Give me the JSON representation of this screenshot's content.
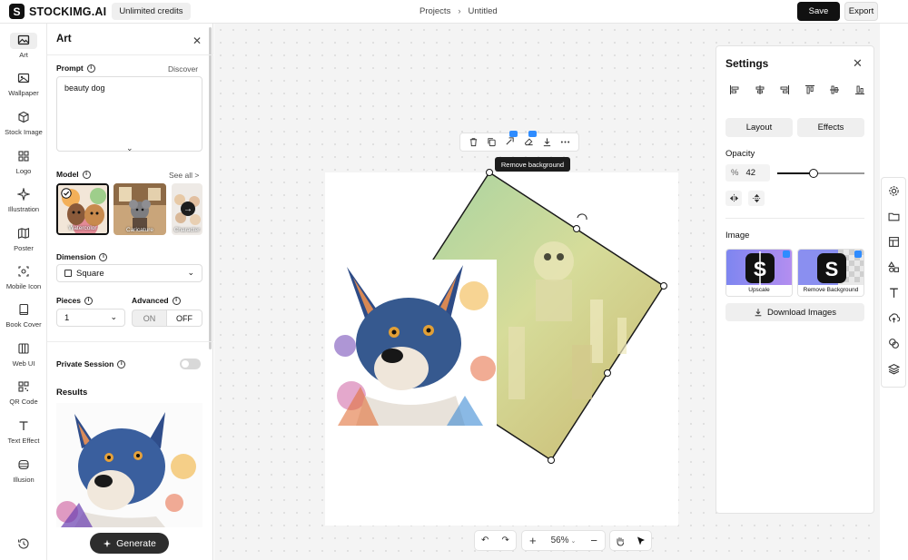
{
  "app": {
    "brand": "STOCKIMG.AI",
    "logo_letter": "S",
    "credits": "Unlimited credits",
    "breadcrumb": [
      "Projects",
      "Untitled"
    ],
    "save_label": "Save",
    "export_label": "Export"
  },
  "sidebar": {
    "items": [
      {
        "label": "Art",
        "icon": "image-icon",
        "active": true
      },
      {
        "label": "Wallpaper",
        "icon": "wallpaper-icon"
      },
      {
        "label": "Stock Image",
        "icon": "cube-icon"
      },
      {
        "label": "Logo",
        "icon": "grid-icon"
      },
      {
        "label": "Illustration",
        "icon": "sparkle-icon"
      },
      {
        "label": "Poster",
        "icon": "map-icon"
      },
      {
        "label": "Mobile Icon",
        "icon": "target-icon"
      },
      {
        "label": "Book Cover",
        "icon": "book-icon"
      },
      {
        "label": "Web UI",
        "icon": "columns-icon"
      },
      {
        "label": "QR Code",
        "icon": "qr-icon"
      },
      {
        "label": "Text Effect",
        "icon": "text-icon"
      },
      {
        "label": "Illusion",
        "icon": "layers-icon"
      }
    ],
    "history_icon": "history-icon"
  },
  "panel": {
    "title": "Art",
    "prompt_label": "Prompt",
    "discover": "Discover",
    "prompt_value": "beauty dog",
    "model_label": "Model",
    "see_all": "See all >",
    "models": [
      {
        "name": "Watercolor",
        "selected": true
      },
      {
        "name": "Caricature",
        "selected": false
      },
      {
        "name": "Character",
        "selected": false
      }
    ],
    "dimension_label": "Dimension",
    "dimension_value": "Square",
    "pieces_label": "Pieces",
    "pieces_value": "1",
    "advanced_label": "Advanced",
    "advanced_on": "ON",
    "advanced_off": "OFF",
    "advanced_state": "OFF",
    "private_label": "Private Session",
    "private_enabled": false,
    "results_label": "Results",
    "generate_label": "Generate"
  },
  "canvas": {
    "toolbar_icons": [
      "trash-icon",
      "duplicate-icon",
      "upscale-icon",
      "eraser-icon",
      "download-icon",
      "more-icon"
    ],
    "tooltip": "Remove background",
    "zoom": "56%"
  },
  "settings": {
    "title": "Settings",
    "align_icons": [
      "align-left-icon",
      "align-center-h-icon",
      "align-right-icon",
      "align-top-icon",
      "align-middle-icon",
      "align-bottom-icon"
    ],
    "tabs": [
      "Layout",
      "Effects"
    ],
    "opacity_label": "Opacity",
    "opacity_symbol": "%",
    "opacity_value": "42",
    "opacity_fraction": 0.42,
    "image_label": "Image",
    "image_actions": [
      "Upscale",
      "Remove Background"
    ],
    "download_label": "Download Images"
  },
  "colors": {
    "primary": "#111111",
    "accent_badge": "#2f8cff",
    "canvas_bg": "#f4f4f4"
  }
}
